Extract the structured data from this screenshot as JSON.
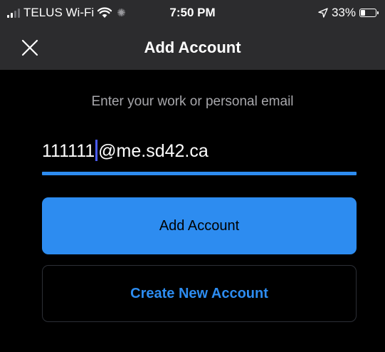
{
  "status_bar": {
    "carrier": "TELUS Wi-Fi",
    "time": "7:50 PM",
    "battery_percent": "33%",
    "battery_level": 0.33,
    "icons": [
      "signal-icon",
      "wifi-icon",
      "activity-spinner-icon",
      "location-arrow-icon",
      "battery-icon"
    ]
  },
  "nav": {
    "title": "Add Account",
    "close_icon": "close-icon"
  },
  "form": {
    "prompt": "Enter your work or personal email",
    "email_before_caret": "111111",
    "email_after_caret": "@me.sd42.ca",
    "email_value": "111111@me.sd42.ca"
  },
  "buttons": {
    "add_account": "Add Account",
    "create_new_account": "Create New Account"
  },
  "colors": {
    "accent": "#2d8cf0",
    "caret": "#4a5cff",
    "header_bg": "#2c2c2e",
    "background": "#000000",
    "prompt_text": "#a7a7ab"
  }
}
